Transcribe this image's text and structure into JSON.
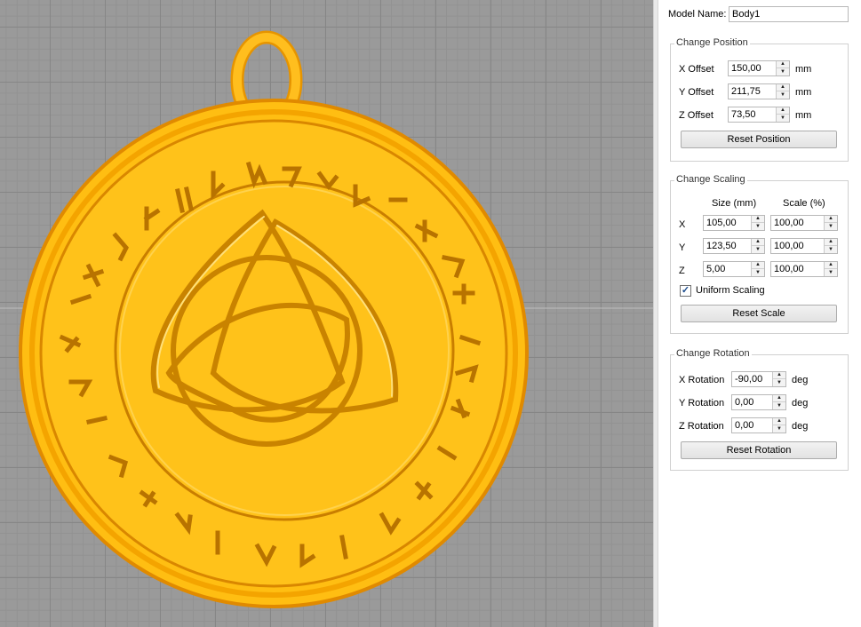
{
  "model": {
    "name_label": "Model Name:",
    "name_value": "Body1"
  },
  "position": {
    "title": "Change Position",
    "fields": [
      {
        "label": "X Offset",
        "value": "150,00",
        "unit": "mm"
      },
      {
        "label": "Y Offset",
        "value": "211,75",
        "unit": "mm"
      },
      {
        "label": "Z Offset",
        "value": "73,50",
        "unit": "mm"
      }
    ],
    "reset_label": "Reset Position"
  },
  "scaling": {
    "title": "Change Scaling",
    "col_size": "Size (mm)",
    "col_scale": "Scale (%)",
    "rows": [
      {
        "axis": "X",
        "size": "105,00",
        "scale": "100,00"
      },
      {
        "axis": "Y",
        "size": "123,50",
        "scale": "100,00"
      },
      {
        "axis": "Z",
        "size": "5,00",
        "scale": "100,00"
      }
    ],
    "uniform_label": "Uniform Scaling",
    "uniform_checked": true,
    "reset_label": "Reset Scale"
  },
  "rotation": {
    "title": "Change Rotation",
    "fields": [
      {
        "label": "X Rotation",
        "value": "-90,00",
        "unit": "deg"
      },
      {
        "label": "Y Rotation",
        "value": "0,00",
        "unit": "deg"
      },
      {
        "label": "Z Rotation",
        "value": "0,00",
        "unit": "deg"
      }
    ],
    "reset_label": "Reset Rotation"
  },
  "colors": {
    "model": "#ffc20e",
    "model_shadow": "#e08a00",
    "grid_bg": "#9a9a9a"
  },
  "icons": {
    "spin_up": "up-arrow-icon",
    "spin_down": "down-arrow-icon",
    "check": "checkmark-icon"
  }
}
